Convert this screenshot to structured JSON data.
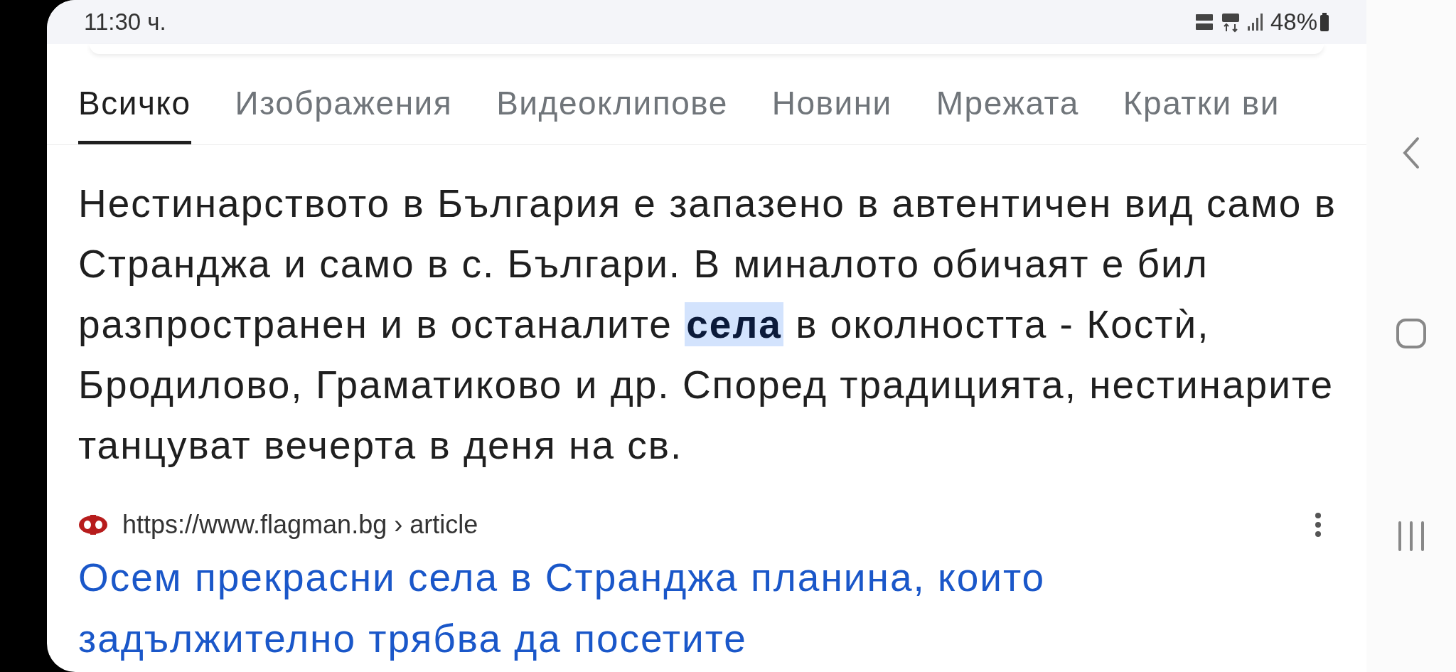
{
  "status_bar": {
    "time": "11:30 ч.",
    "battery": "48%"
  },
  "tabs": [
    {
      "label": "Всичко",
      "selected": true
    },
    {
      "label": "Изображения",
      "selected": false
    },
    {
      "label": "Видеоклипове",
      "selected": false
    },
    {
      "label": "Новини",
      "selected": false
    },
    {
      "label": "Мрежата",
      "selected": false
    },
    {
      "label": "Кратки ви",
      "selected": false
    }
  ],
  "snippet": "Нестинарството в България е запазено в автентичен вид само в Странджа и само в с. Българи. В миналото обичаят е бил разпространен и в останалите **села** в околността - Костѝ, Бродилово, Граматиково и др. Според традицията, нестинарите танцуват вечерта в деня на св.",
  "result": {
    "url": "https://www.flagman.bg › article",
    "title": "Осем прекрасни села в Странджа планина, които задължително трябва да посетите"
  }
}
